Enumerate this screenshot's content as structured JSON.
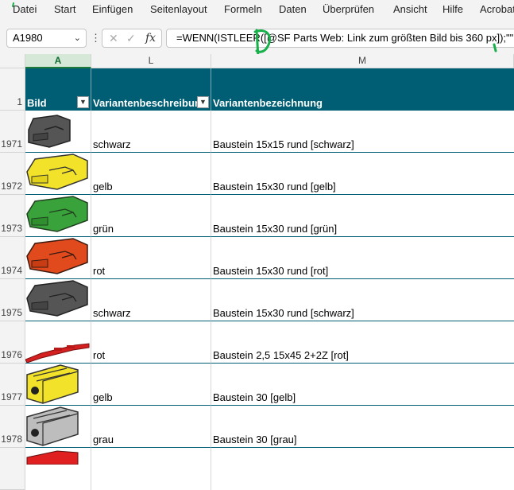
{
  "menu": [
    "Datei",
    "Start",
    "Einfügen",
    "Seitenlayout",
    "Formeln",
    "Daten",
    "Überprüfen",
    "Ansicht",
    "Hilfe",
    "Acrobat"
  ],
  "formula_bar": {
    "name_box": "A1980",
    "formula": "=WENN(ISTLEER([@SF Parts Web: Link zum größten Bild bis 360 px]);\"\""
  },
  "columns": [
    "A",
    "L",
    "M"
  ],
  "table_header": {
    "row_number": "1",
    "col_a": "Bild",
    "col_l": "Variantenbeschreibung",
    "col_m": "Variantenbezeichnung"
  },
  "rows": [
    {
      "row": "1971",
      "icon": "black-brick-15x15-icon",
      "color": "#555555",
      "beschreibung": "schwarz",
      "bezeichnung": "Baustein 15x15 rund [schwarz]"
    },
    {
      "row": "1972",
      "icon": "yellow-brick-15x30-icon",
      "color": "#f2e32a",
      "beschreibung": "gelb",
      "bezeichnung": "Baustein 15x30 rund [gelb]"
    },
    {
      "row": "1973",
      "icon": "green-brick-15x30-icon",
      "color": "#3aa23a",
      "beschreibung": "grün",
      "bezeichnung": "Baustein 15x30 rund [grün]"
    },
    {
      "row": "1974",
      "icon": "red-brick-15x30-icon",
      "color": "#e04a1c",
      "beschreibung": "rot",
      "bezeichnung": "Baustein 15x30 rund [rot]"
    },
    {
      "row": "1975",
      "icon": "black-brick-15x30-icon",
      "color": "#555555",
      "beschreibung": "schwarz",
      "bezeichnung": "Baustein 15x30 rund [schwarz]"
    },
    {
      "row": "1976",
      "icon": "red-flat-brick-icon",
      "color": "#d42020",
      "beschreibung": "rot",
      "bezeichnung": "Baustein 2,5 15x45 2+2Z [rot]"
    },
    {
      "row": "1977",
      "icon": "yellow-brick-30-icon",
      "color": "#f2e32a",
      "beschreibung": "gelb",
      "bezeichnung": "Baustein 30 [gelb]"
    },
    {
      "row": "1978",
      "icon": "grey-brick-30-icon",
      "color": "#bdbdbd",
      "beschreibung": "grau",
      "bezeichnung": "Baustein 30 [grau]"
    },
    {
      "row": "",
      "icon": "red-brick-partial-icon",
      "color": "#e02020",
      "beschreibung": "",
      "bezeichnung": ""
    }
  ]
}
